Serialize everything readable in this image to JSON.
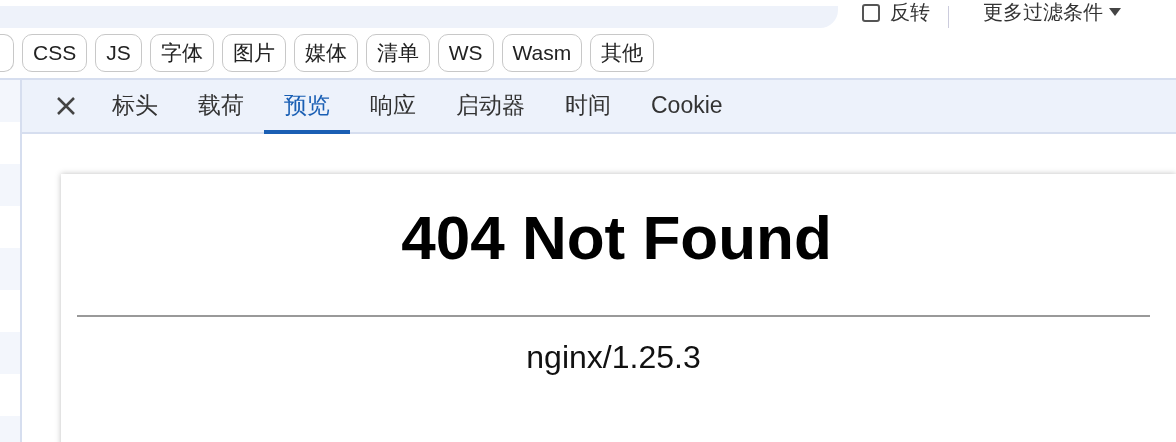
{
  "toolbar": {
    "invert": {
      "label": "反转",
      "checked": false
    },
    "more_filters": "更多过滤条件"
  },
  "filter_chips": [
    {
      "label": "CSS",
      "selected": false
    },
    {
      "label": "JS",
      "selected": false
    },
    {
      "label": "字体",
      "selected": false
    },
    {
      "label": "图片",
      "selected": false
    },
    {
      "label": "媒体",
      "selected": false
    },
    {
      "label": "清单",
      "selected": false
    },
    {
      "label": "WS",
      "selected": false
    },
    {
      "label": "Wasm",
      "selected": false
    },
    {
      "label": "其他",
      "selected": false
    }
  ],
  "detail_tabs": [
    {
      "label": "标头",
      "selected": false
    },
    {
      "label": "载荷",
      "selected": false
    },
    {
      "label": "预览",
      "selected": true
    },
    {
      "label": "响应",
      "selected": false
    },
    {
      "label": "启动器",
      "selected": false
    },
    {
      "label": "时间",
      "selected": false
    },
    {
      "label": "Cookie",
      "selected": false
    }
  ],
  "preview": {
    "heading": "404 Not Found",
    "server": "nginx/1.25.3"
  }
}
